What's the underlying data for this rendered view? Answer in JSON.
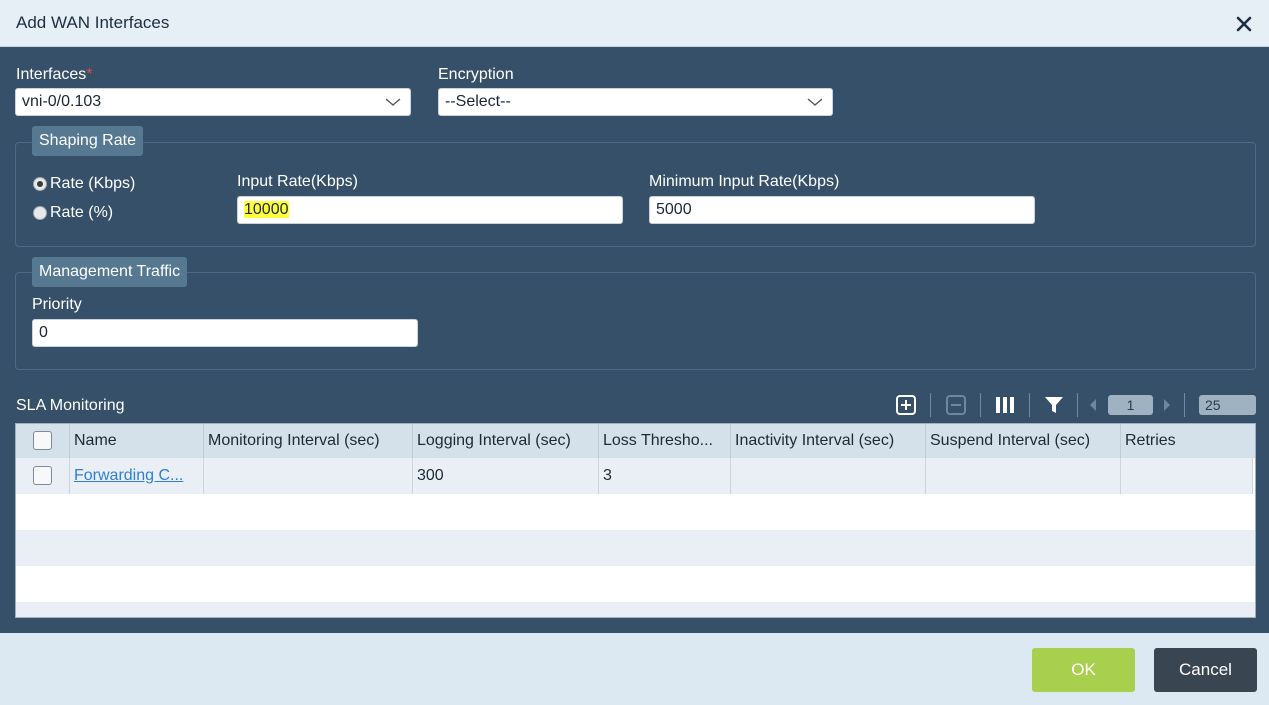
{
  "dialog": {
    "title": "Add WAN Interfaces"
  },
  "interfaces": {
    "label": "Interfaces",
    "required_mark": "*",
    "value": "vni-0/0.103"
  },
  "encryption": {
    "label": "Encryption",
    "value": "--Select--"
  },
  "shaping": {
    "legend": "Shaping Rate",
    "radio_kbps": "Rate (Kbps)",
    "radio_pct": "Rate (%)",
    "selected": "Rate (Kbps)",
    "input_rate_label": "Input Rate(Kbps)",
    "input_rate_value": "10000",
    "min_rate_label": "Minimum Input Rate(Kbps)",
    "min_rate_value": "5000"
  },
  "management": {
    "legend": "Management Traffic",
    "priority_label": "Priority",
    "priority_value": "0"
  },
  "sla": {
    "title": "SLA Monitoring",
    "page_number": "1",
    "page_size": "25",
    "columns": [
      "Name",
      "Monitoring Interval (sec)",
      "Logging Interval (sec)",
      "Loss Thresho...",
      "Inactivity Interval (sec)",
      "Suspend Interval (sec)",
      "Retries"
    ],
    "rows": [
      {
        "name": "Forwarding C...",
        "monitoring": "",
        "logging": "300",
        "loss": "3",
        "inactivity": "",
        "suspend": "",
        "retries": ""
      }
    ]
  },
  "footer": {
    "ok_label": "OK",
    "cancel_label": "Cancel"
  },
  "colors": {
    "ok": "#a9cf4e",
    "cancel": "#3a4552",
    "body": "#355068",
    "highlight": "#ffff3a",
    "link": "#2f7fcf"
  },
  "icons": [
    "close-icon",
    "chevron-down-icon",
    "add-icon",
    "remove-icon",
    "columns-icon",
    "filter-icon",
    "prev-page-icon",
    "next-page-icon"
  ]
}
